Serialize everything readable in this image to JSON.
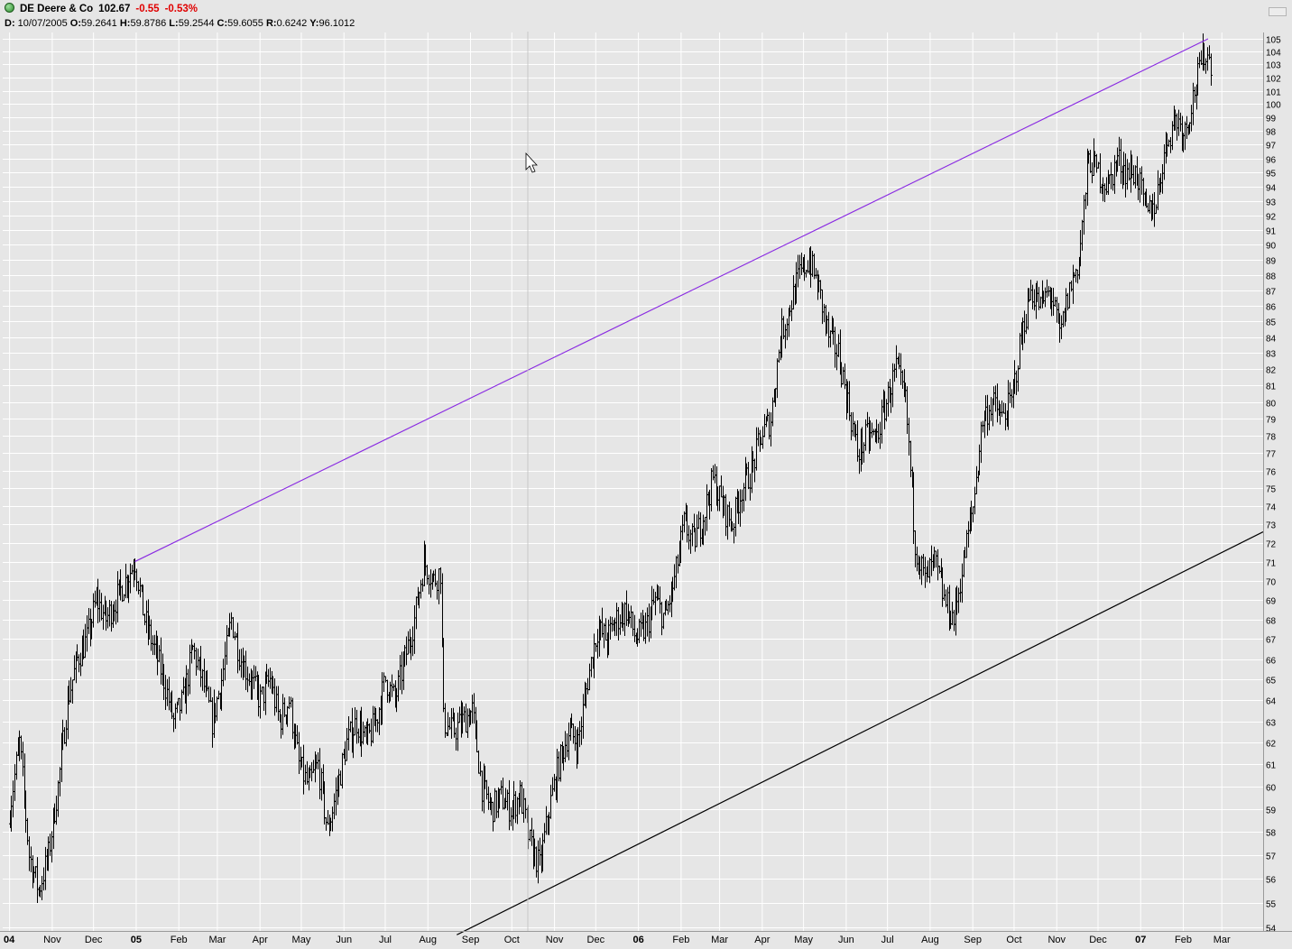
{
  "header": {
    "symbol_title": "DE Deere & Co",
    "last_price": "102.67",
    "change": "-0.55",
    "change_pct": "-0.53%",
    "status_icon": "green-status-dot-icon"
  },
  "ohlc": {
    "d_label": "D:",
    "date": "10/07/2005",
    "o_label": "O:",
    "open": "59.2641",
    "h_label": "H:",
    "high": "59.8786",
    "l_label": "L:",
    "low": "59.2544",
    "c_label": "C:",
    "close": "59.6055",
    "r_label": "R:",
    "range": "0.6242",
    "y_label": "Y:",
    "y_value": "96.1012"
  },
  "colors": {
    "background": "#e6e6e6",
    "grid": "#ffffff",
    "bars": "#000000",
    "upper_trendline": "#8a2be2",
    "lower_trendline": "#000000",
    "negative": "#e00000"
  },
  "chart_data": {
    "type": "bar",
    "scale": "log",
    "ylim": [
      54,
      105
    ],
    "y_ticks": [
      54,
      55,
      56,
      57,
      58,
      59,
      60,
      61,
      62,
      63,
      64,
      65,
      66,
      67,
      68,
      69,
      70,
      71,
      72,
      73,
      74,
      75,
      76,
      77,
      78,
      79,
      80,
      81,
      82,
      83,
      84,
      85,
      86,
      87,
      88,
      89,
      90,
      91,
      92,
      93,
      94,
      95,
      96,
      97,
      98,
      99,
      100,
      101,
      102,
      103,
      104,
      105
    ],
    "x_ticks": [
      "04",
      "Nov",
      "Dec",
      "05",
      "Feb",
      "Mar",
      "Apr",
      "May",
      "Jun",
      "Jul",
      "Aug",
      "Sep",
      "Oct",
      "Nov",
      "Dec",
      "06",
      "Feb",
      "Mar",
      "Apr",
      "May",
      "Jun",
      "Jul",
      "Aug",
      "Sep",
      "Oct",
      "Nov",
      "Dec",
      "07",
      "Feb",
      "Mar"
    ],
    "bold_x_ticks": [
      "04",
      "05",
      "06",
      "07"
    ],
    "series": [
      {
        "path": [
          [
            "2004-10-01",
            59
          ],
          [
            "2004-10-08",
            62
          ],
          [
            "2004-10-15",
            57
          ],
          [
            "2004-10-22",
            55.5
          ],
          [
            "2004-10-29",
            57
          ],
          [
            "2004-11-05",
            60
          ],
          [
            "2004-11-12",
            64
          ],
          [
            "2004-11-19",
            66
          ],
          [
            "2004-11-26",
            67
          ],
          [
            "2004-12-03",
            69
          ],
          [
            "2004-12-10",
            68
          ],
          [
            "2004-12-17",
            69
          ],
          [
            "2004-12-24",
            70
          ],
          [
            "2004-12-31",
            71
          ],
          [
            "2005-01-07",
            68
          ],
          [
            "2005-01-14",
            66.5
          ],
          [
            "2005-01-21",
            65
          ],
          [
            "2005-01-28",
            63
          ],
          [
            "2005-02-04",
            64
          ],
          [
            "2005-02-11",
            66.5
          ],
          [
            "2005-02-18",
            65
          ],
          [
            "2005-02-25",
            63
          ],
          [
            "2005-03-04",
            65
          ],
          [
            "2005-03-11",
            68
          ],
          [
            "2005-03-18",
            66
          ],
          [
            "2005-03-25",
            65
          ],
          [
            "2005-04-01",
            64
          ],
          [
            "2005-04-08",
            65
          ],
          [
            "2005-04-15",
            63
          ],
          [
            "2005-04-22",
            64
          ],
          [
            "2005-04-29",
            61
          ],
          [
            "2005-05-06",
            60
          ],
          [
            "2005-05-13",
            61
          ],
          [
            "2005-05-20",
            58
          ],
          [
            "2005-05-27",
            60
          ],
          [
            "2005-06-03",
            62
          ],
          [
            "2005-06-10",
            63
          ],
          [
            "2005-06-17",
            62
          ],
          [
            "2005-06-24",
            63
          ],
          [
            "2005-07-01",
            65
          ],
          [
            "2005-07-08",
            64
          ],
          [
            "2005-07-15",
            66
          ],
          [
            "2005-07-22",
            68
          ],
          [
            "2005-07-29",
            71
          ],
          [
            "2005-08-05",
            70
          ],
          [
            "2005-08-10",
            70.5
          ],
          [
            "2005-08-12",
            63
          ],
          [
            "2005-08-19",
            62.5
          ],
          [
            "2005-08-26",
            63
          ],
          [
            "2005-09-02",
            63.5
          ],
          [
            "2005-09-09",
            60
          ],
          [
            "2005-09-16",
            59
          ],
          [
            "2005-09-23",
            59.5
          ],
          [
            "2005-09-30",
            59
          ],
          [
            "2005-10-07",
            59.6
          ],
          [
            "2005-10-14",
            57.5
          ],
          [
            "2005-10-21",
            56.5
          ],
          [
            "2005-10-28",
            59
          ],
          [
            "2005-11-04",
            61
          ],
          [
            "2005-11-11",
            62.5
          ],
          [
            "2005-11-18",
            62
          ],
          [
            "2005-11-25",
            65
          ],
          [
            "2005-12-02",
            67.5
          ],
          [
            "2005-12-09",
            67
          ],
          [
            "2005-12-16",
            68
          ],
          [
            "2005-12-23",
            68.5
          ],
          [
            "2005-12-30",
            67
          ],
          [
            "2006-01-06",
            67.5
          ],
          [
            "2006-01-13",
            69
          ],
          [
            "2006-01-20",
            68
          ],
          [
            "2006-01-27",
            70
          ],
          [
            "2006-02-03",
            73
          ],
          [
            "2006-02-10",
            72
          ],
          [
            "2006-02-17",
            73.5
          ],
          [
            "2006-02-24",
            75.5
          ],
          [
            "2006-03-03",
            74
          ],
          [
            "2006-03-10",
            73
          ],
          [
            "2006-03-17",
            75
          ],
          [
            "2006-03-24",
            76
          ],
          [
            "2006-03-31",
            78
          ],
          [
            "2006-04-07",
            79
          ],
          [
            "2006-04-14",
            84
          ],
          [
            "2006-04-21",
            86
          ],
          [
            "2006-04-28",
            88
          ],
          [
            "2006-05-05",
            89
          ],
          [
            "2006-05-12",
            87
          ],
          [
            "2006-05-19",
            84
          ],
          [
            "2006-05-26",
            83
          ],
          [
            "2006-06-02",
            80
          ],
          [
            "2006-06-09",
            77
          ],
          [
            "2006-06-16",
            78
          ],
          [
            "2006-06-23",
            78
          ],
          [
            "2006-06-30",
            80
          ],
          [
            "2006-07-07",
            82
          ],
          [
            "2006-07-14",
            80
          ],
          [
            "2006-07-21",
            72
          ],
          [
            "2006-07-28",
            70
          ],
          [
            "2006-08-04",
            71
          ],
          [
            "2006-08-11",
            69
          ],
          [
            "2006-08-18",
            68
          ],
          [
            "2006-08-25",
            71
          ],
          [
            "2006-09-01",
            74
          ],
          [
            "2006-09-08",
            79
          ],
          [
            "2006-09-15",
            80
          ],
          [
            "2006-09-22",
            79
          ],
          [
            "2006-09-29",
            80
          ],
          [
            "2006-10-06",
            84
          ],
          [
            "2006-10-13",
            87
          ],
          [
            "2006-10-20",
            86
          ],
          [
            "2006-10-27",
            87
          ],
          [
            "2006-11-03",
            84
          ],
          [
            "2006-11-10",
            87
          ],
          [
            "2006-11-17",
            89
          ],
          [
            "2006-11-24",
            96
          ],
          [
            "2006-12-01",
            95
          ],
          [
            "2006-12-08",
            94
          ],
          [
            "2006-12-15",
            96
          ],
          [
            "2006-12-22",
            95
          ],
          [
            "2006-12-29",
            95
          ],
          [
            "2007-01-05",
            92
          ],
          [
            "2007-01-12",
            93
          ],
          [
            "2007-01-19",
            97
          ],
          [
            "2007-01-26",
            99
          ],
          [
            "2007-02-02",
            98
          ],
          [
            "2007-02-09",
            101
          ],
          [
            "2007-02-16",
            104
          ],
          [
            "2007-02-22",
            103
          ]
        ]
      }
    ],
    "trendlines": [
      {
        "name": "upper",
        "from": [
          "2004-12-31",
          71
        ],
        "to": [
          "2007-02-19",
          105
        ]
      },
      {
        "name": "lower",
        "from": [
          "2005-08-22",
          53.7
        ],
        "to": [
          "2007-03-31",
          72.6
        ]
      }
    ]
  }
}
